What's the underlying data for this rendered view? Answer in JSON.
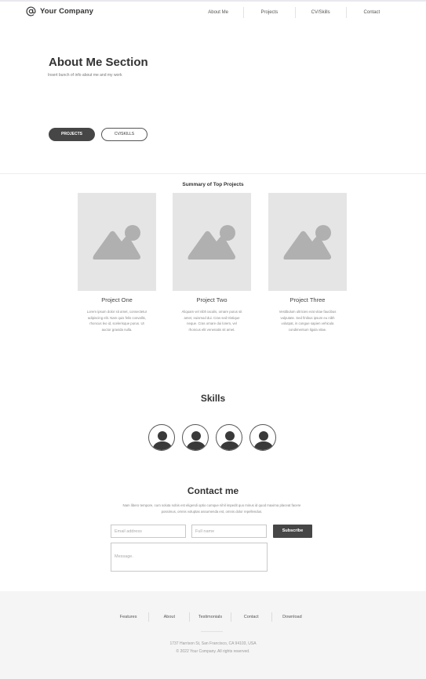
{
  "colors": {
    "dark": "#464646",
    "placeholder_bg": "#e5e5e5",
    "placeholder_shape": "#b0b0b0",
    "footer_bg": "#f5f5f5"
  },
  "header": {
    "brand_icon": "at-sign-icon",
    "brand_name": "Your Company",
    "nav": [
      "About Me",
      "Projects",
      "CV/Skills",
      "Contact"
    ]
  },
  "hero": {
    "title": "About Me Section",
    "subtitle": "Insert bunch of info about me and my work",
    "btn_projects": "PROJECTS",
    "btn_cv": "CV/SKILLS"
  },
  "projects": {
    "heading": "Summary of Top Projects",
    "image_icon": "image-placeholder-icon",
    "items": [
      {
        "title": "Project One",
        "desc": "Lorem ipsum dolor sit amet, consectetur adipiscing elit. Nam quis felis convallis, rhoncus leo id, scelerisque purus. Ut auctor gravida nulla."
      },
      {
        "title": "Project Two",
        "desc": "Aliquam vel nibh iaculis, ornare purus sit amet, euismod dui. Cras sed tristique neque. Cras ornare dui lorem, vel rhoncus elit venenatis sit amet."
      },
      {
        "title": "Project Three",
        "desc": "Vestibulum ultricies erat vitae faucibus vulputate. Sed finibus ipsum eu nibh volutpat, in congue sapien vehicula condimentum ligula vitae."
      }
    ]
  },
  "skills": {
    "title": "Skills",
    "avatar_icon": "user-avatar-icon",
    "count": 4
  },
  "contact": {
    "title": "Contact me",
    "desc": "Nam libero tempore, cum soluta nobis est eligendi optio cumque nihil impedit quo minus id quod maxima placeat facere possimus, omnis voluptas assumenda est, omnis dolor repellendus.",
    "email_placeholder": "Email address",
    "name_placeholder": "Full name",
    "subscribe": "Subscribe",
    "message_placeholder": "Message."
  },
  "footer": {
    "links": [
      "Features",
      "About",
      "Testimonials",
      "Contact",
      "Download"
    ],
    "address": "1737 Harrison St, San Francisco, CA 94103, USA",
    "copyright": "© 2022 Your Company.  All rights reserved."
  }
}
